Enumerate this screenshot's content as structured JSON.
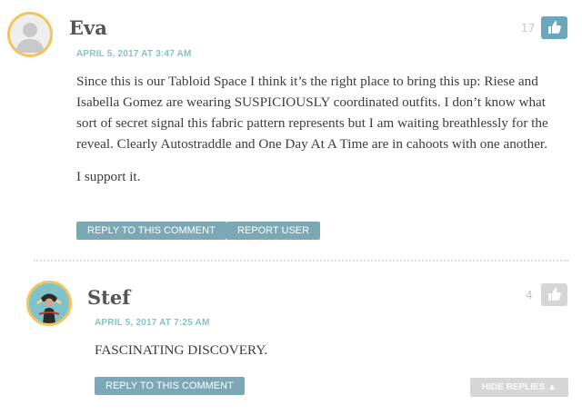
{
  "comments": [
    {
      "author": "Eva",
      "date": "APRIL 5, 2017 AT 3:47 AM",
      "likes": "17",
      "body": [
        "Since this is our Tabloid Space I think it’s the right place to bring this up: Riese and Isabella Gomez are wearing SUSPICIOUSLY coordinated outfits. I don’t know what sort of secret signal this fabric pattern represents but I am waiting breathlessly for the reveal. Clearly Autostraddle and One Day At A Time are in cahoots with one another.",
        "I support it."
      ],
      "reply_label": "REPLY TO THIS COMMENT",
      "report_label": "REPORT USER"
    },
    {
      "author": "Stef",
      "date": "APRIL 5, 2017 AT 7:25 AM",
      "likes": "4",
      "body": "FASCINATING DISCOVERY.",
      "reply_label": "REPLY TO THIS COMMENT",
      "hide_replies_label": "HIDE REPLIES ▲"
    }
  ],
  "colors": {
    "accent": "#7fc4cc",
    "button": "#7ca8b6",
    "like_active": "#6ba6ba",
    "like_inactive": "#d5d5d5",
    "avatar_ring": "#f3c45b"
  },
  "icons": {
    "avatar_default": "default-avatar-icon",
    "avatar_stef": "user-avatar-photo",
    "like": "thumbs-up-icon"
  }
}
